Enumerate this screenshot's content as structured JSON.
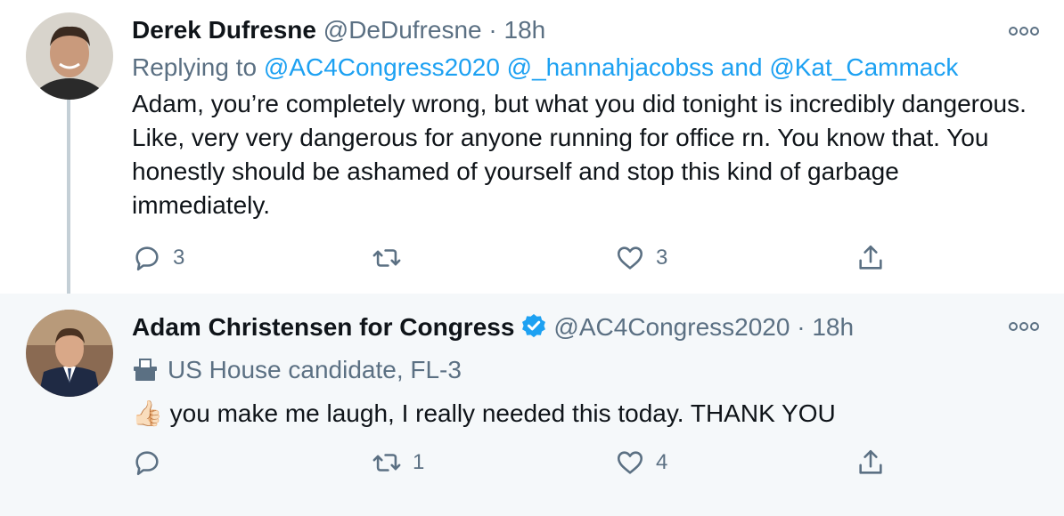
{
  "tweet1": {
    "author_name": "Derek Dufresne",
    "handle": "@DeDufresne",
    "dot": "·",
    "time": "18h",
    "replying_to_label": "Replying to",
    "mention1": "@AC4Congress2020",
    "mention2": "@_hannahjacobss",
    "and_text": "and",
    "mention3": "@Kat_Cammack",
    "text": "Adam, you’re completely wrong, but what you did tonight is incredibly dangerous. Like, very very dangerous for anyone running for office rn. You know that. You honestly should be ashamed of yourself and stop this kind of garbage immediately.",
    "reply_count": "3",
    "retweet_count": "",
    "like_count": "3"
  },
  "tweet2": {
    "author_name": "Adam Christensen for Congress",
    "handle": "@AC4Congress2020",
    "dot": "·",
    "time": "18h",
    "bio": "US House candidate, FL-3",
    "emoji": "👍🏻",
    "text": "you make me laugh, I really needed this today. THANK YOU",
    "reply_count": "",
    "retweet_count": "1",
    "like_count": "4"
  },
  "colors": {
    "link": "#1da1f2",
    "muted": "#5b7083",
    "thread_line": "#c4cfd6",
    "highlight_bg": "#f5f8fa"
  }
}
